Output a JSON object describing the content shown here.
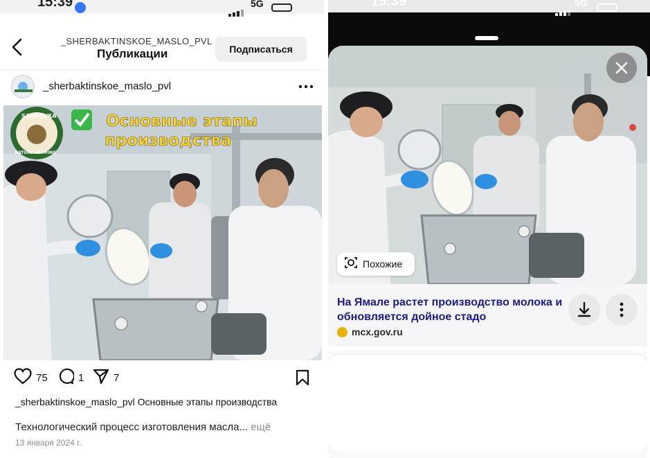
{
  "left_status": {
    "time": "15:39",
    "network": "5G"
  },
  "left_header": {
    "account": "_SHERBAKTINSKOE_MASLO_PVL",
    "title": "Публикации",
    "follow_label": "Подписаться"
  },
  "post": {
    "author": "_sherbaktinskoe_maslo_pvl",
    "overlay_title_1": "Основные этапы",
    "overlay_title_2": "производства",
    "logo_text_top": "SANNOVKA",
    "logo_text_bottom": "NATURE FARMING",
    "likes": "75",
    "comments": "1",
    "shares": "7",
    "caption_author": "_sherbaktinskoe_maslo_pvl",
    "caption_text": " Основные этапы производства",
    "description": "Технологический процесс изготовления масла...",
    "more_label": "ещё",
    "date": "13 января 2024 г."
  },
  "right_status": {
    "time": "15:39",
    "network": "5G"
  },
  "viewer": {
    "similar_label": "Похожие",
    "headline": "На Ямале растет производство молока и обновляется дойное стадо",
    "source": "mcx.gov.ru"
  },
  "colors": {
    "link_blue": "#1a1a8c",
    "overlay_yellow": "#f5d33a",
    "glove_blue": "#2f8fe0",
    "check_green": "#3cb64b"
  },
  "icons": [
    "back-chevron-icon",
    "more-dots-icon",
    "heart-icon",
    "comment-icon",
    "share-icon",
    "bookmark-icon",
    "close-icon",
    "lens-icon",
    "download-icon",
    "vertical-dots-icon",
    "favicon"
  ]
}
